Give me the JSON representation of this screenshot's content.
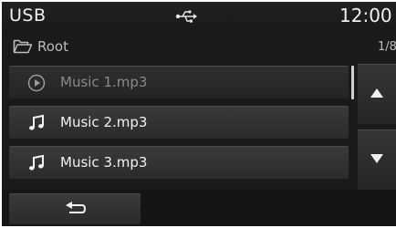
{
  "status": {
    "source": "USB",
    "time": "12:00",
    "connection_icon": "usb-icon"
  },
  "folder": {
    "icon": "folder-open-icon",
    "name": "Root",
    "page": "1/8"
  },
  "tracks": [
    {
      "label": "Music 1.mp3",
      "icon": "play-circle-icon",
      "state": "playing"
    },
    {
      "label": "Music 2.mp3",
      "icon": "music-note-icon",
      "state": "normal"
    },
    {
      "label": "Music 3.mp3",
      "icon": "music-note-icon",
      "state": "normal"
    }
  ],
  "controls": {
    "scroll_up_icon": "triangle-up-icon",
    "scroll_down_icon": "triangle-down-icon",
    "back_icon": "back-arrow-icon"
  },
  "colors": {
    "background": "#1a1a1a",
    "button": "#333333",
    "text": "#f2f2f2",
    "dim_text": "#8a8a8a"
  }
}
